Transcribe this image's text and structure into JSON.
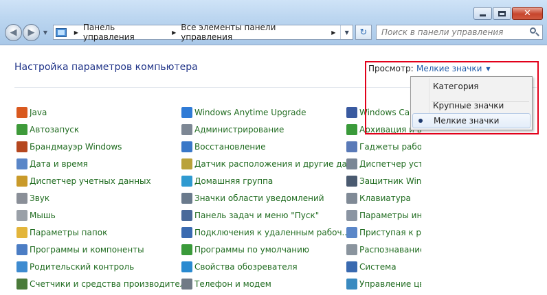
{
  "window": {
    "caption_buttons": [
      {
        "name": "minimize-button",
        "icon": "minimize-icon"
      },
      {
        "name": "maximize-button",
        "icon": "maximize-icon"
      },
      {
        "name": "close-button",
        "icon": "close-icon",
        "glyph": "✕"
      }
    ]
  },
  "nav": {
    "back_glyph": "◀",
    "forward_glyph": "▶",
    "history_glyph": "▼"
  },
  "address": {
    "segments": [
      "Панель управления",
      "Все элементы панели управления"
    ],
    "arrow": "▶",
    "dropdown": "▼",
    "refresh_glyph": "↻"
  },
  "search": {
    "placeholder": "Поиск в панели управления"
  },
  "header": {
    "title": "Настройка параметров компьютера",
    "view_label": "Просмотр:",
    "view_value": "Мелкие значки",
    "view_arrow": "▼"
  },
  "menu": {
    "items": [
      {
        "label": "Категория",
        "selected": false
      },
      {
        "label": "Крупные значки",
        "selected": false
      },
      {
        "label": "Мелкие значки",
        "selected": true
      }
    ]
  },
  "items": {
    "col1": [
      {
        "label": "Java",
        "icon": "java-icon",
        "color": "#d9591f"
      },
      {
        "label": "Автозапуск",
        "icon": "autoplay-icon",
        "color": "#3e9a3a"
      },
      {
        "label": "Брандмауэр Windows",
        "icon": "firewall-icon",
        "color": "#b5471f"
      },
      {
        "label": "Дата и время",
        "icon": "clock-icon",
        "color": "#5a86c8"
      },
      {
        "label": "Диспетчер учетных данных",
        "icon": "credential-icon",
        "color": "#c99a2a"
      },
      {
        "label": "Звук",
        "icon": "speaker-icon",
        "color": "#8a8f98"
      },
      {
        "label": "Мышь",
        "icon": "mouse-icon",
        "color": "#9aa0a8"
      },
      {
        "label": "Параметры папок",
        "icon": "folder-icon",
        "color": "#e3b53b"
      },
      {
        "label": "Программы и компоненты",
        "icon": "programs-icon",
        "color": "#4b7dc4"
      },
      {
        "label": "Родительский контроль",
        "icon": "parental-icon",
        "color": "#3e8bd0"
      },
      {
        "label": "Счетчики и средства производител...",
        "icon": "performance-icon",
        "color": "#4a7a3a"
      }
    ],
    "col2": [
      {
        "label": "Windows Anytime Upgrade",
        "icon": "windows-icon",
        "color": "#2f7bd6"
      },
      {
        "label": "Администрирование",
        "icon": "admin-icon",
        "color": "#7d8794"
      },
      {
        "label": "Восстановление",
        "icon": "recovery-icon",
        "color": "#3a78c8"
      },
      {
        "label": "Датчик расположения и другие дат...",
        "icon": "sensor-icon",
        "color": "#b9a23a"
      },
      {
        "label": "Домашняя группа",
        "icon": "homegroup-icon",
        "color": "#2f9ad0"
      },
      {
        "label": "Значки области уведомлений",
        "icon": "tray-icon",
        "color": "#6a7a8c"
      },
      {
        "label": "Панель задач и меню \"Пуск\"",
        "icon": "taskbar-icon",
        "color": "#4a6a9a"
      },
      {
        "label": "Подключения к удаленным рабоч...",
        "icon": "remote-icon",
        "color": "#3a6ab0"
      },
      {
        "label": "Программы по умолчанию",
        "icon": "default-programs-icon",
        "color": "#3a9a3a"
      },
      {
        "label": "Свойства обозревателя",
        "icon": "internet-options-icon",
        "color": "#2a8ad0"
      },
      {
        "label": "Телефон и модем",
        "icon": "phone-icon",
        "color": "#707a86"
      }
    ],
    "col3": [
      {
        "label": "Windows CardSpace",
        "icon": "cardspace-icon",
        "color": "#3a5aa0"
      },
      {
        "label": "Архивация и восстановление",
        "icon": "backup-icon",
        "color": "#3a9a3a"
      },
      {
        "label": "Гаджеты рабочего стола",
        "icon": "gadgets-icon",
        "color": "#5a7ab8"
      },
      {
        "label": "Диспетчер устройств",
        "icon": "device-manager-icon",
        "color": "#7a8696"
      },
      {
        "label": "Защитник Windows",
        "icon": "defender-icon",
        "color": "#4a5a70"
      },
      {
        "label": "Клавиатура",
        "icon": "keyboard-icon",
        "color": "#808a96"
      },
      {
        "label": "Параметры индексирования",
        "icon": "indexing-icon",
        "color": "#8a94a2"
      },
      {
        "label": "Приступая к работе",
        "icon": "getting-started-icon",
        "color": "#5a86c8"
      },
      {
        "label": "Распознавание речи",
        "icon": "microphone-icon",
        "color": "#8a949e"
      },
      {
        "label": "Система",
        "icon": "system-icon",
        "color": "#3a6ab0"
      },
      {
        "label": "Управление цветом",
        "icon": "color-management-icon",
        "color": "#3a8ac0"
      }
    ]
  }
}
